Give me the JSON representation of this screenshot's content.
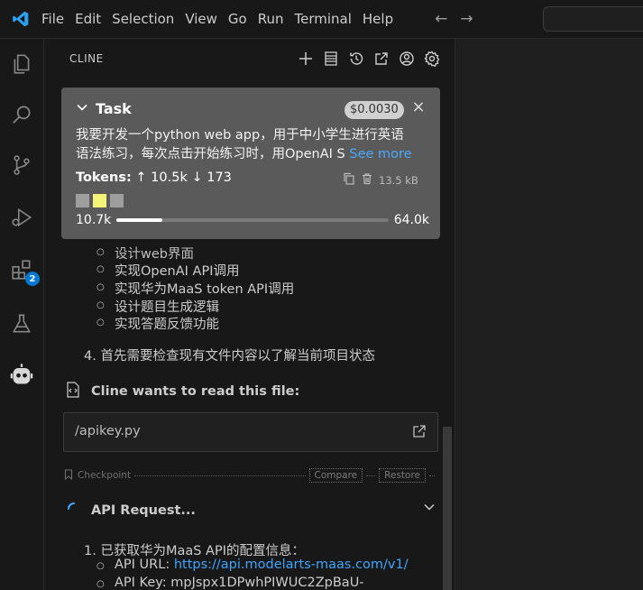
{
  "menu": [
    "File",
    "Edit",
    "Selection",
    "View",
    "Go",
    "Run",
    "Terminal",
    "Help"
  ],
  "extensions_badge": "2",
  "sidebar": {
    "title": "CLINE"
  },
  "task": {
    "label": "Task",
    "cost": "$0.0030",
    "text_line1": "我要开发一个python web app，用于中小学生进行英语",
    "text_line2": "语法练习，每次点击开始练习时，用OpenAI S",
    "see_more": "See more",
    "tokens_label": "Tokens:",
    "tokens_up": "10.5k",
    "tokens_down": "173",
    "size": "13.5 kB",
    "context_used": "10.7k",
    "context_max": "64.0k",
    "context_fraction": 0.167
  },
  "chat": {
    "partial_line": "设计web界面",
    "sub_items": [
      "实现OpenAI API调用",
      "实现华为MaaS token API调用",
      "设计题目生成逻辑",
      "实现答题反馈功能"
    ],
    "step4": "4. 首先需要检查现有文件内容以了解当前项目状态",
    "read_title": "Cline wants to read this file:",
    "file_path": "/apikey.py",
    "checkpoint_label": "Checkpoint",
    "compare_label": "Compare",
    "restore_label": "Restore",
    "api_title": "API Request...",
    "step1": "1. 已获取华为MaaS API的配置信息：",
    "api_url_label": "API URL: ",
    "api_url": "https://api.modelarts-maas.com/v1/",
    "api_key_line": "API Key: mpJspx1DPwhPIWUC2ZpBaU-"
  },
  "colors": {
    "accent": "#0078d4",
    "link": "#3ea6ff",
    "highlight": "#f3f37a",
    "card": "#5a5a5a"
  }
}
